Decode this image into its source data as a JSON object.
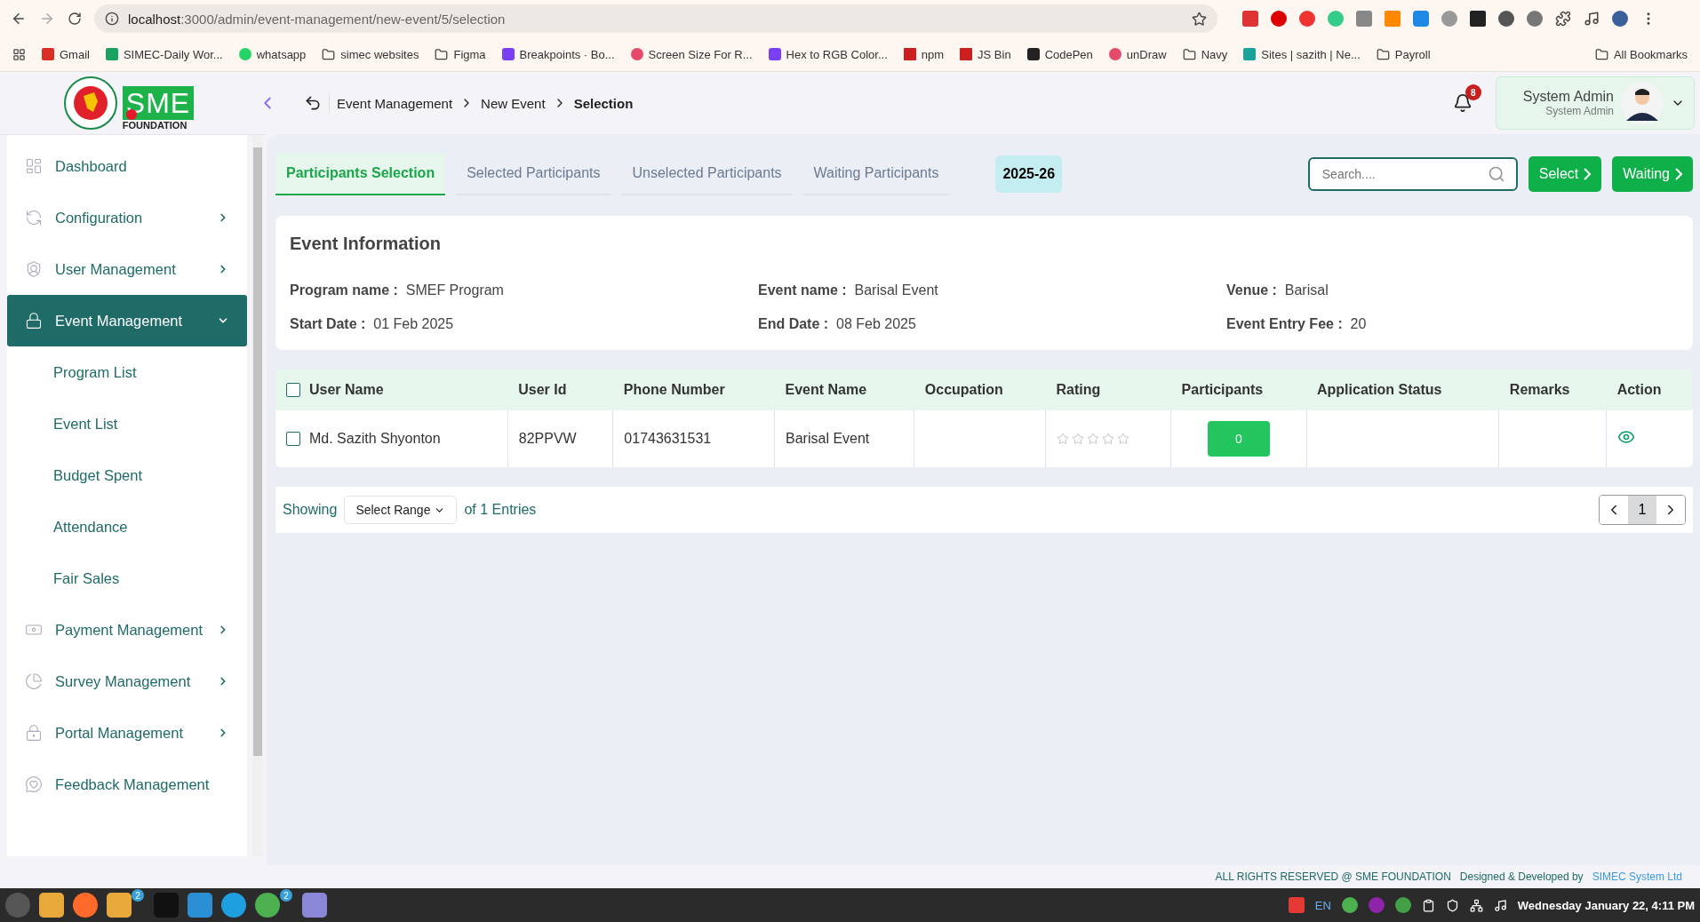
{
  "browser": {
    "url_host": "localhost",
    "url_path": ":3000/admin/event-management/new-event/5/selection",
    "bookmarks": [
      {
        "label": "Gmail",
        "kind": "mail"
      },
      {
        "label": "SIMEC-Daily Wor...",
        "kind": "sheet"
      },
      {
        "label": "whatsapp",
        "kind": "chat"
      },
      {
        "label": "simec websites",
        "kind": "folder"
      },
      {
        "label": "Figma",
        "kind": "folder"
      },
      {
        "label": "Breakpoints · Bo...",
        "kind": "letter"
      },
      {
        "label": "Screen Size For R...",
        "kind": "ring"
      },
      {
        "label": "Hex to RGB Color...",
        "kind": "letter"
      },
      {
        "label": "npm",
        "kind": "square"
      },
      {
        "label": "JS Bin",
        "kind": "square"
      },
      {
        "label": "CodePen",
        "kind": "cube"
      },
      {
        "label": "unDraw",
        "kind": "ring"
      },
      {
        "label": "Navy",
        "kind": "folder"
      },
      {
        "label": "Sites | sazith | Ne...",
        "kind": "diamond"
      },
      {
        "label": "Payroll",
        "kind": "folder"
      }
    ],
    "all_bookmarks": "All Bookmarks"
  },
  "logo": {
    "letters": "SME",
    "caption": "FOUNDATION"
  },
  "breadcrumbs": [
    {
      "label": "Event Management",
      "current": false
    },
    {
      "label": "New Event",
      "current": false
    },
    {
      "label": "Selection",
      "current": true
    }
  ],
  "notifications": {
    "count": "8"
  },
  "user": {
    "name": "System Admin",
    "role": "System Admin"
  },
  "sidebar": {
    "items": [
      {
        "label": "Dashboard",
        "has_submenu": false,
        "selected": false
      },
      {
        "label": "Configuration",
        "has_submenu": true,
        "selected": false,
        "expanded": false
      },
      {
        "label": "User Management",
        "has_submenu": true,
        "selected": false,
        "expanded": false
      },
      {
        "label": "Event Management",
        "has_submenu": true,
        "selected": true,
        "expanded": true,
        "children": [
          {
            "label": "Program List"
          },
          {
            "label": "Event List"
          },
          {
            "label": "Budget Spent"
          },
          {
            "label": "Attendance"
          },
          {
            "label": "Fair Sales"
          }
        ]
      },
      {
        "label": "Payment Management",
        "has_submenu": true,
        "selected": false,
        "expanded": false
      },
      {
        "label": "Survey Management",
        "has_submenu": true,
        "selected": false,
        "expanded": false
      },
      {
        "label": "Portal Management",
        "has_submenu": true,
        "selected": false,
        "expanded": false
      },
      {
        "label": "Feedback Management",
        "has_submenu": false,
        "selected": false
      }
    ]
  },
  "tabs": [
    {
      "label": "Participants Selection",
      "selected": true
    },
    {
      "label": "Selected Participants",
      "selected": false
    },
    {
      "label": "Unselected Participants",
      "selected": false
    },
    {
      "label": "Waiting Participants",
      "selected": false
    }
  ],
  "year": "2025-26",
  "search": {
    "placeholder": "Search...."
  },
  "buttons": [
    "Select",
    "Waiting"
  ],
  "event_info": {
    "title": "Event Information",
    "fields": [
      {
        "label": "Program name :",
        "value": "SMEF Program"
      },
      {
        "label": "Event name :",
        "value": "Barisal Event"
      },
      {
        "label": "Venue :",
        "value": "Barisal"
      },
      {
        "label": "Start Date :",
        "value": "01 Feb 2025"
      },
      {
        "label": "End Date :",
        "value": "08 Feb 2025"
      },
      {
        "label": "Event Entry Fee :",
        "value": "20"
      }
    ]
  },
  "table": {
    "select_all_checked": false,
    "columns": [
      "User Name",
      "User Id",
      "Phone Number",
      "Event Name",
      "Occupation",
      "Rating",
      "Participants",
      "Application Status",
      "Remarks",
      "Action"
    ],
    "rows": [
      {
        "checked": false,
        "user_name": "Md. Sazith Shyonton",
        "user_id": "82PPVW",
        "phone": "01743631531",
        "event_name": "Barisal Event",
        "stars": 0,
        "participants": "0"
      }
    ]
  },
  "pagination": {
    "showing": "Showing",
    "range": "Select Range",
    "entries": "of 1 Entries",
    "pages": [
      {
        "label": "1",
        "selected": true
      }
    ]
  },
  "footer": {
    "rights": "ALL RIGHTS RESERVED @ SME FOUNDATION",
    "designed": "Designed & Developed by",
    "company": "SIMEC System Ltd"
  },
  "taskbar": {
    "badges": [
      "2",
      "2"
    ],
    "language": "EN",
    "clock": "Wednesday January 22, 4:11 PM"
  }
}
